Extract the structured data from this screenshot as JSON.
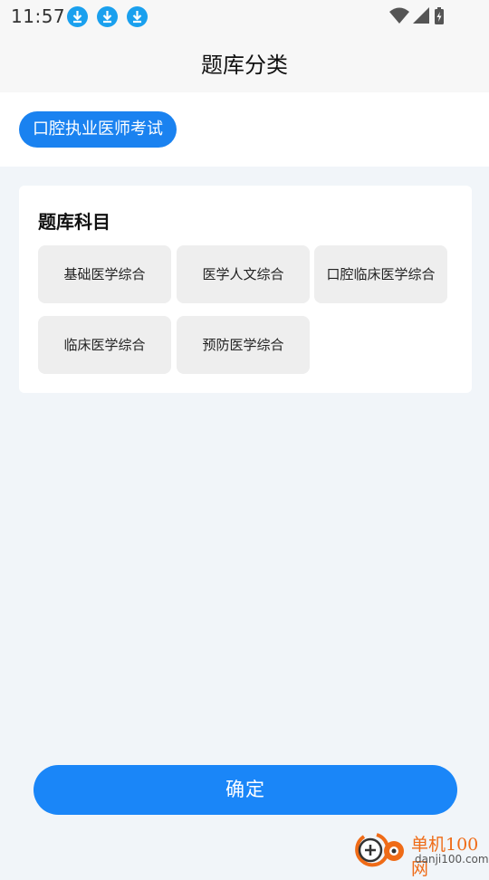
{
  "status_bar": {
    "time": "11:57",
    "download_icons": [
      "download-icon",
      "download-icon",
      "download-icon"
    ],
    "system_icons": [
      "wifi-icon",
      "signal-icon",
      "battery-charging-icon"
    ]
  },
  "header": {
    "title": "题库分类"
  },
  "category": {
    "selected": "口腔执业医师考试"
  },
  "subjects": {
    "title": "题库科目",
    "items": [
      {
        "label": "基础医学综合"
      },
      {
        "label": "医学人文综合"
      },
      {
        "label": "口腔临床医学综合"
      },
      {
        "label": "临床医学综合"
      },
      {
        "label": "预防医学综合"
      }
    ]
  },
  "footer": {
    "confirm_label": "确定"
  },
  "watermark": {
    "brand": "单机100网",
    "domain": "danji100.com"
  },
  "colors": {
    "accent": "#1a86f8",
    "chip": "#1a82f0",
    "background": "#f1f5f9",
    "watermark_orange": "#ef6b17"
  }
}
